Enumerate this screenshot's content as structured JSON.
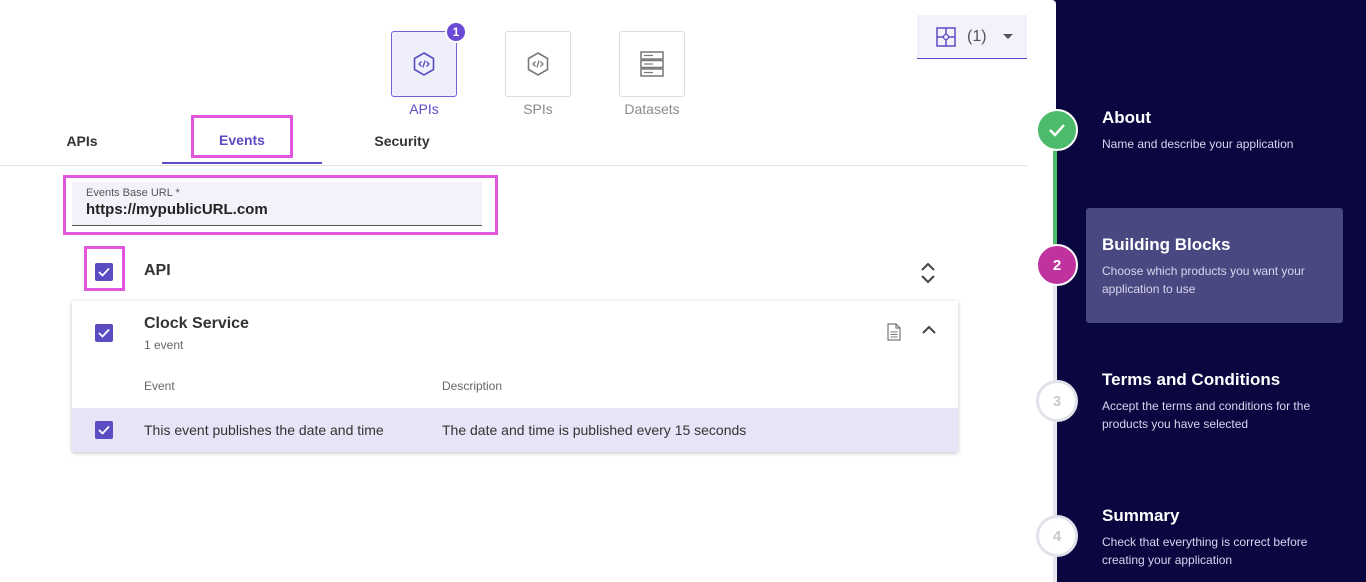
{
  "block_types": [
    {
      "label": "APIs",
      "badge": "1"
    },
    {
      "label": "SPIs"
    },
    {
      "label": "Datasets"
    }
  ],
  "dropdown": {
    "count_label": "(1)"
  },
  "tabs": [
    {
      "label": "APIs"
    },
    {
      "label": "Events"
    },
    {
      "label": "Security"
    }
  ],
  "events_base_url": {
    "label": "Events Base URL *",
    "value": "https://mypublicURL.com"
  },
  "api_group": {
    "label": "API"
  },
  "service": {
    "name": "Clock Service",
    "count": "1 event",
    "columns": {
      "event": "Event",
      "description": "Description"
    },
    "rows": [
      {
        "event": "This event publishes the date and time",
        "description": "The date and time is published every 15 seconds"
      }
    ]
  },
  "steps": [
    {
      "number": "",
      "title": "About",
      "desc": "Name and describe your application",
      "state": "done"
    },
    {
      "number": "2",
      "title": "Building Blocks",
      "desc": "Choose which products you want your application to use",
      "state": "active"
    },
    {
      "number": "3",
      "title": "Terms and Conditions",
      "desc": "Accept the terms and conditions for the products you have selected",
      "state": "pending"
    },
    {
      "number": "4",
      "title": "Summary",
      "desc": "Check that everything is correct before creating your application",
      "state": "pending"
    }
  ],
  "colors": {
    "accent": "#5b4cc4",
    "done": "#4cbb6c",
    "active_step": "#c0339f",
    "sidebar_bg": "#0a0640"
  }
}
